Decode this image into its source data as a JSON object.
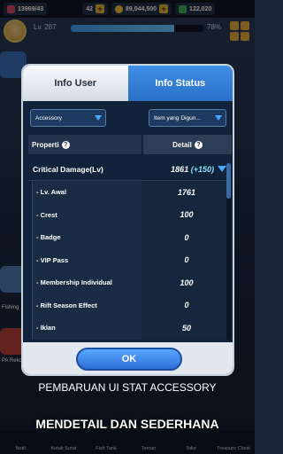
{
  "hud": {
    "gems": "13969/43",
    "energy": "42",
    "gold": "89,044,500",
    "cash": "122,020",
    "level": "Lv. 287",
    "xp_percent": "78%",
    "xp_fill": 0.78
  },
  "side": {
    "left_label_1": "Fishing",
    "left_label_2": "PA Rekom"
  },
  "bottom_nav": [
    "Notif.",
    "Kotak Surat",
    "Fish Tank",
    "Teman",
    "Toko",
    "Treasure Chest"
  ],
  "modal": {
    "tab_user": "Info User",
    "tab_status": "Info Status",
    "dropdown_left": "Accessory",
    "dropdown_right": "Item yang Digun...",
    "col_property": "Properti",
    "col_detail": "Detail",
    "critical": {
      "label": "Critical Damage(Lv)",
      "value": "1861",
      "bonus": "(+150)"
    },
    "rows": [
      {
        "label": "- Lv. Awal",
        "value": "1761"
      },
      {
        "label": "- Crest",
        "value": "100"
      },
      {
        "label": "- Badge",
        "value": "0"
      },
      {
        "label": "- VIP Pass",
        "value": "0"
      },
      {
        "label": "- Membership Individual",
        "value": "100"
      },
      {
        "label": "- Rift Season Effect",
        "value": "0"
      },
      {
        "label": "- Iklan",
        "value": "50"
      }
    ],
    "ok_label": "OK"
  },
  "captions": {
    "line1": "PEMBARUAN UI STAT ACCESSORY",
    "line2": "MENDETAIL DAN SEDERHANA"
  },
  "colors": {
    "accent": "#3f8fe6",
    "ok_button": "#2e6fd6",
    "bonus": "#8fe0ff"
  }
}
